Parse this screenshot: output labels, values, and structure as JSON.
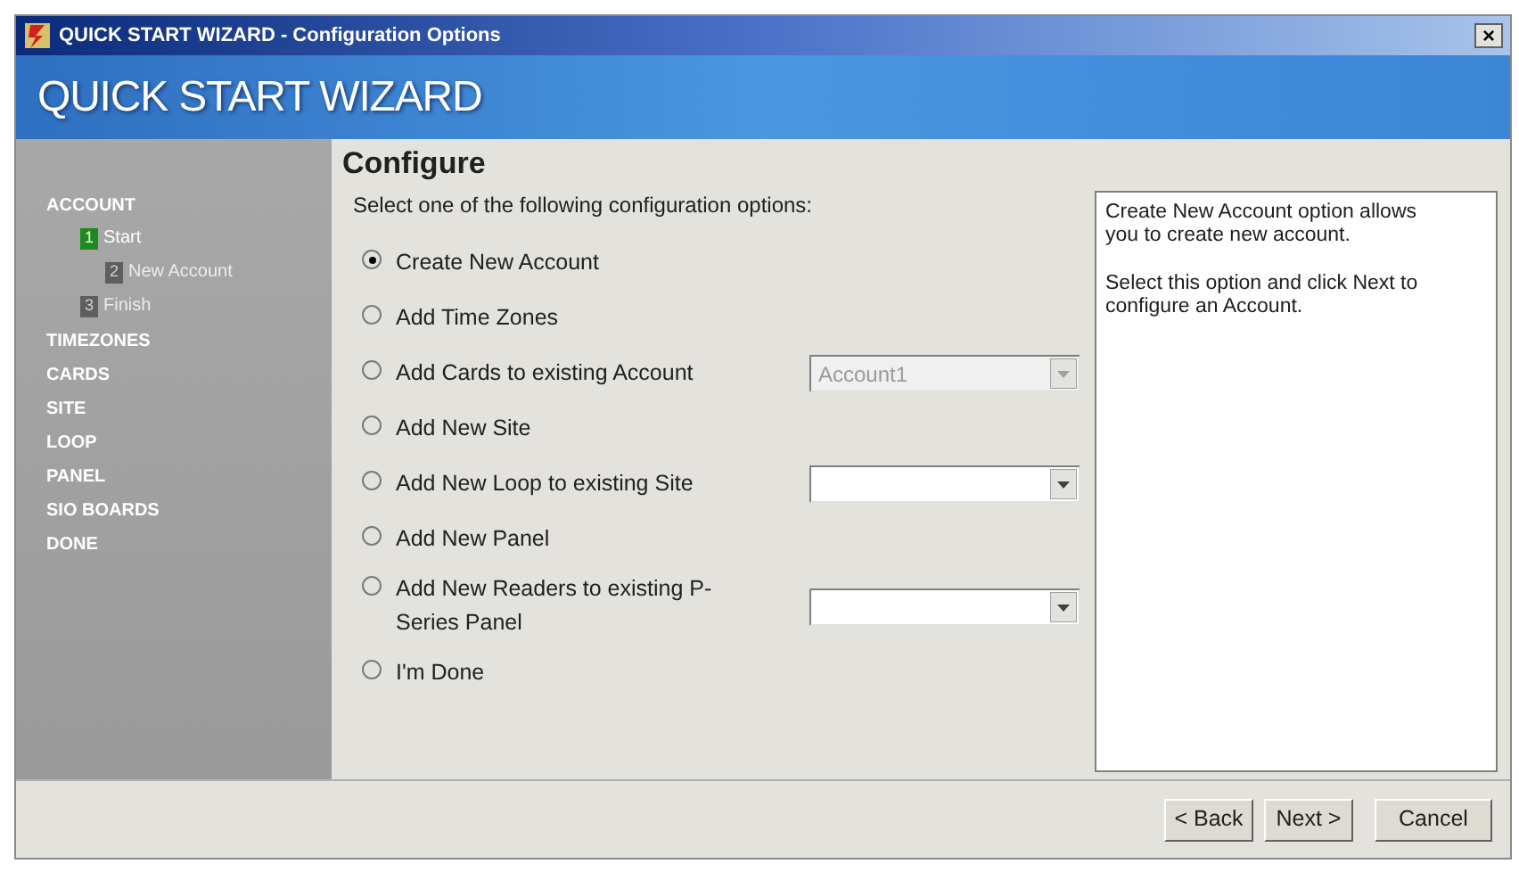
{
  "window": {
    "title": "QUICK START WIZARD - Configuration Options",
    "close": "×"
  },
  "banner": {
    "title": "QUICK START WIZARD"
  },
  "sidebar": {
    "sections": [
      {
        "label": "ACCOUNT",
        "steps": [
          {
            "number": "1",
            "label": "Start",
            "selected": true,
            "sub": false
          },
          {
            "number": "2",
            "label": "New Account",
            "selected": false,
            "sub": true
          },
          {
            "number": "3",
            "label": "Finish",
            "selected": false,
            "sub": false
          }
        ]
      },
      {
        "label": "TIMEZONES"
      },
      {
        "label": "CARDS"
      },
      {
        "label": "SITE"
      },
      {
        "label": "LOOP"
      },
      {
        "label": "PANEL"
      },
      {
        "label": "SIO BOARDS"
      },
      {
        "label": "DONE"
      }
    ]
  },
  "content": {
    "heading": "Configure",
    "prompt": "Select one of the following configuration options:",
    "options": [
      {
        "label": "Create New Account",
        "selected": true
      },
      {
        "label": "Add Time Zones",
        "selected": false
      },
      {
        "label": "Add Cards to existing Account",
        "selected": false,
        "dropdown": {
          "value": "Account1",
          "disabled": true
        }
      },
      {
        "label": "Add New Site",
        "selected": false
      },
      {
        "label": "Add New Loop to existing Site",
        "selected": false,
        "dropdown": {
          "disabled": false
        }
      },
      {
        "label": "Add New Panel",
        "selected": false
      },
      {
        "label": "Add New Readers to existing P-Series Panel",
        "selected": false,
        "dropdown": {
          "disabled": false
        }
      },
      {
        "label": "I'm Done",
        "selected": false
      }
    ]
  },
  "help": {
    "paragraphs": [
      "Create New Account option allows you to create new account.",
      "Select this option and click Next to configure an Account."
    ]
  },
  "buttons": [
    "< Back",
    "Next >",
    "Cancel"
  ]
}
